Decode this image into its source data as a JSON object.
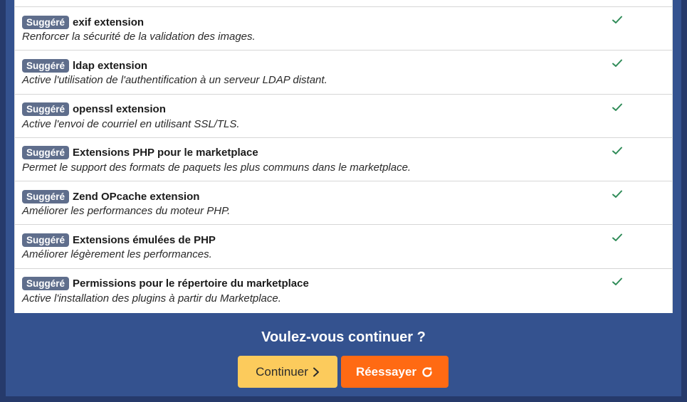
{
  "checks": [
    {
      "badge": "Suggéré",
      "name": "exif extension",
      "description": "Renforcer la sécurité de la validation des images.",
      "status": "ok"
    },
    {
      "badge": "Suggéré",
      "name": "ldap extension",
      "description": "Active l'utilisation de l'authentification à un serveur LDAP distant.",
      "status": "ok"
    },
    {
      "badge": "Suggéré",
      "name": "openssl extension",
      "description": "Active l'envoi de courriel en utilisant SSL/TLS.",
      "status": "ok"
    },
    {
      "badge": "Suggéré",
      "name": "Extensions PHP pour le marketplace",
      "description": "Permet le support des formats de paquets les plus communs dans le marketplace.",
      "status": "ok"
    },
    {
      "badge": "Suggéré",
      "name": "Zend OPcache extension",
      "description": "Améliorer les performances du moteur PHP.",
      "status": "ok"
    },
    {
      "badge": "Suggéré",
      "name": "Extensions émulées de PHP",
      "description": "Améliorer légèrement les performances.",
      "status": "ok"
    },
    {
      "badge": "Suggéré",
      "name": "Permissions pour le répertoire du marketplace",
      "description": "Active l'installation des plugins à partir du Marketplace.",
      "status": "ok"
    }
  ],
  "footer": {
    "question": "Voulez-vous continuer ?",
    "continue_label": "Continuer",
    "continue_icon": "chevron-right-icon",
    "retry_label": "Réessayer",
    "retry_icon": "refresh-icon"
  },
  "colors": {
    "background": "#263a6b",
    "panel": "#34528f",
    "badge": "#5f6e8c",
    "check": "#2e8b57",
    "continue_button": "#fccb5c",
    "retry_button": "#ff6a13"
  }
}
